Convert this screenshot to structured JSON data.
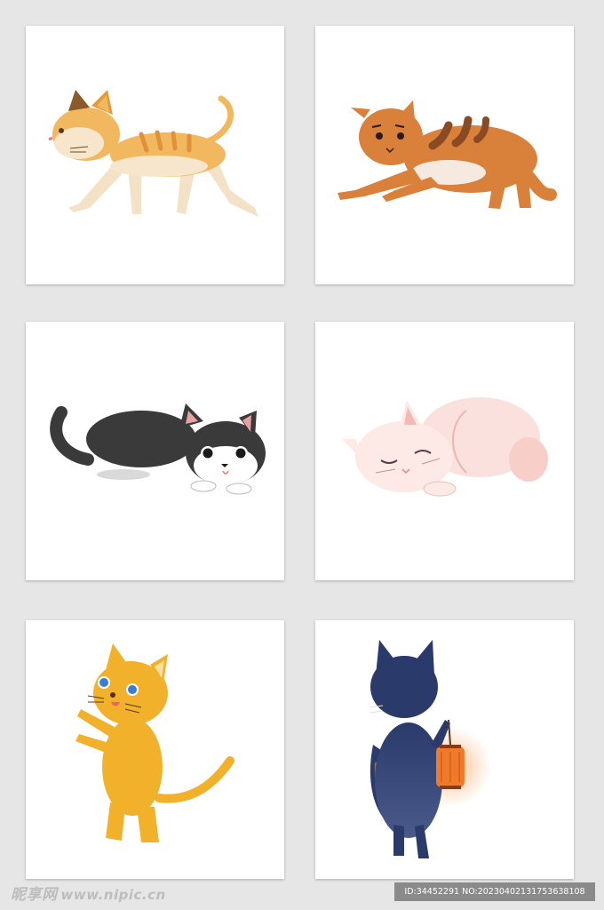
{
  "gallery": {
    "items": [
      {
        "subject": "orange-tabby-cat-walking"
      },
      {
        "subject": "brown-striped-cat-lying"
      },
      {
        "subject": "black-white-cat-crouching"
      },
      {
        "subject": "pink-cat-sleeping"
      },
      {
        "subject": "yellow-cat-standing"
      },
      {
        "subject": "blue-cat-with-lantern"
      }
    ]
  },
  "footer": {
    "brand": "昵享网",
    "url": "www.nipic.cn",
    "id_text": "ID:34452291 NO:20230402131753638108"
  },
  "colors": {
    "background": "#e6e6e6",
    "card": "#ffffff",
    "orange": "#f2b85f",
    "brown": "#d9803a",
    "dark": "#3a3a3a",
    "pink": "#fbe1dd",
    "yellow": "#f1b12b",
    "navy": "#2a3a6a",
    "lantern": "#f07a2a"
  }
}
